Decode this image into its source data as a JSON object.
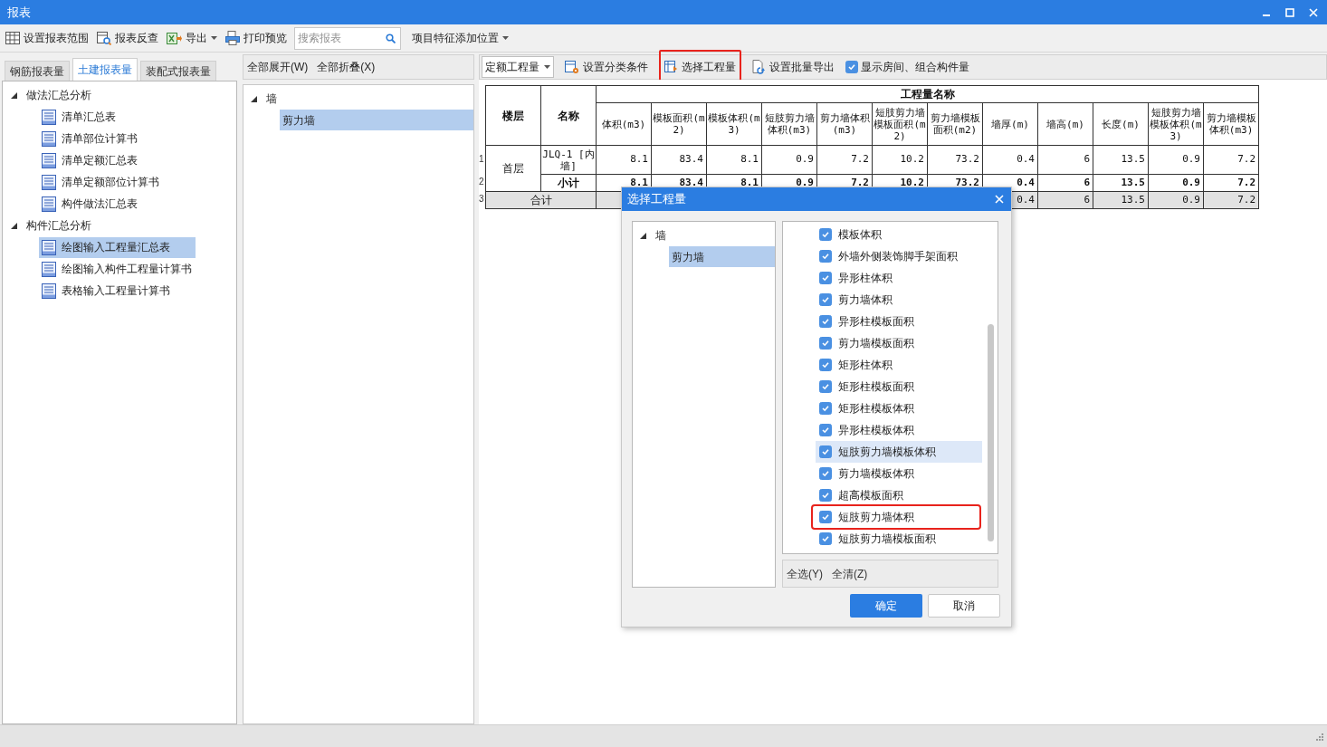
{
  "window": {
    "title": "报表"
  },
  "toolbar": [
    {
      "kind": "button",
      "label": "设置报表范围"
    },
    {
      "kind": "button",
      "label": "报表反查"
    },
    {
      "kind": "dropdown",
      "label": "导出"
    },
    {
      "kind": "button",
      "label": "打印预览"
    },
    {
      "kind": "search",
      "placeholder": "搜索报表"
    },
    {
      "kind": "dropdown",
      "label": "项目特征添加位置"
    }
  ],
  "left_panel": {
    "tabs": [
      {
        "label": "钢筋报表量",
        "selected": false
      },
      {
        "label": "土建报表量",
        "selected": true
      },
      {
        "label": "装配式报表量",
        "selected": false
      }
    ],
    "tree": [
      {
        "label": "做法汇总分析",
        "expanded": true,
        "children": [
          {
            "label": "清单汇总表",
            "selected": false
          },
          {
            "label": "清单部位计算书",
            "selected": false
          },
          {
            "label": "清单定额汇总表",
            "selected": false
          },
          {
            "label": "清单定额部位计算书",
            "selected": false
          },
          {
            "label": "构件做法汇总表",
            "selected": false
          }
        ]
      },
      {
        "label": "构件汇总分析",
        "expanded": true,
        "children": [
          {
            "label": "绘图输入工程量汇总表",
            "selected": true
          },
          {
            "label": "绘图输入构件工程量计算书",
            "selected": false
          },
          {
            "label": "表格输入工程量计算书",
            "selected": false
          }
        ]
      }
    ]
  },
  "middle_panel": {
    "actions": [
      "全部展开(W)",
      "全部折叠(X)"
    ],
    "tree": [
      {
        "label": "墙",
        "expanded": true,
        "children": [
          {
            "label": "剪力墙",
            "selected": true
          }
        ]
      }
    ]
  },
  "report_toolbar": [
    {
      "kind": "select",
      "value": "定额工程量"
    },
    {
      "kind": "button",
      "label": "设置分类条件",
      "marked": false
    },
    {
      "kind": "button",
      "label": "选择工程量",
      "marked": true
    },
    {
      "kind": "button",
      "label": "设置批量导出",
      "marked": false
    },
    {
      "kind": "checkbox",
      "label": "显示房间、组合构件量",
      "checked": true
    }
  ],
  "table": {
    "row_numbers": [
      "1",
      "2",
      "3"
    ],
    "fixed_columns": [
      "楼层",
      "名称"
    ],
    "group_header": "工程量名称",
    "columns": [
      "体积(m3)",
      "模板面积(m2)",
      "模板体积(m3)",
      "短肢剪力墙体积(m3)",
      "剪力墙体积(m3)",
      "短肢剪力墙模板面积(m2)",
      "剪力墙模板面积(m2)",
      "墙厚(m)",
      "墙高(m)",
      "长度(m)",
      "短肢剪力墙模板体积(m3)",
      "剪力墙模板体积(m3)"
    ],
    "rows": [
      {
        "floor": "首层",
        "name": "JLQ-1 [内墙]",
        "values": [
          "8.1",
          "83.4",
          "8.1",
          "0.9",
          "7.2",
          "10.2",
          "73.2",
          "0.4",
          "6",
          "13.5",
          "0.9",
          "7.2"
        ]
      }
    ],
    "subtotal": {
      "label": "小计",
      "values": [
        "8.1",
        "83.4",
        "8.1",
        "0.9",
        "7.2",
        "10.2",
        "73.2",
        "0.4",
        "6",
        "13.5",
        "0.9",
        "7.2"
      ]
    },
    "total": {
      "label": "合计",
      "values": [
        "0.4",
        "6",
        "13.5",
        "0.9",
        "7.2"
      ]
    }
  },
  "dialog": {
    "title": "选择工程量",
    "tree": [
      {
        "label": "墙",
        "expanded": true,
        "children": [
          {
            "label": "剪力墙",
            "selected": true
          }
        ]
      }
    ],
    "items": [
      {
        "label": "模板体积",
        "checked": true,
        "highlighted": false,
        "marked": false
      },
      {
        "label": "外墙外侧装饰脚手架面积",
        "checked": true,
        "highlighted": false,
        "marked": false
      },
      {
        "label": "异形柱体积",
        "checked": true,
        "highlighted": false,
        "marked": false
      },
      {
        "label": "剪力墙体积",
        "checked": true,
        "highlighted": false,
        "marked": false
      },
      {
        "label": "异形柱模板面积",
        "checked": true,
        "highlighted": false,
        "marked": false
      },
      {
        "label": "剪力墙模板面积",
        "checked": true,
        "highlighted": false,
        "marked": false
      },
      {
        "label": "矩形柱体积",
        "checked": true,
        "highlighted": false,
        "marked": false
      },
      {
        "label": "矩形柱模板面积",
        "checked": true,
        "highlighted": false,
        "marked": false
      },
      {
        "label": "矩形柱模板体积",
        "checked": true,
        "highlighted": false,
        "marked": false
      },
      {
        "label": "异形柱模板体积",
        "checked": true,
        "highlighted": false,
        "marked": false
      },
      {
        "label": "短肢剪力墙模板体积",
        "checked": true,
        "highlighted": true,
        "marked": false
      },
      {
        "label": "剪力墙模板体积",
        "checked": true,
        "highlighted": false,
        "marked": false
      },
      {
        "label": "超高模板面积",
        "checked": true,
        "highlighted": false,
        "marked": false
      },
      {
        "label": "短肢剪力墙体积",
        "checked": true,
        "highlighted": false,
        "marked": true
      },
      {
        "label": "短肢剪力墙模板面积",
        "checked": true,
        "highlighted": false,
        "marked": false
      }
    ],
    "actions": [
      "全选(Y)",
      "全清(Z)"
    ],
    "buttons": [
      {
        "label": "确定",
        "kind": "primary"
      },
      {
        "label": "取消",
        "kind": "secondary"
      }
    ]
  }
}
